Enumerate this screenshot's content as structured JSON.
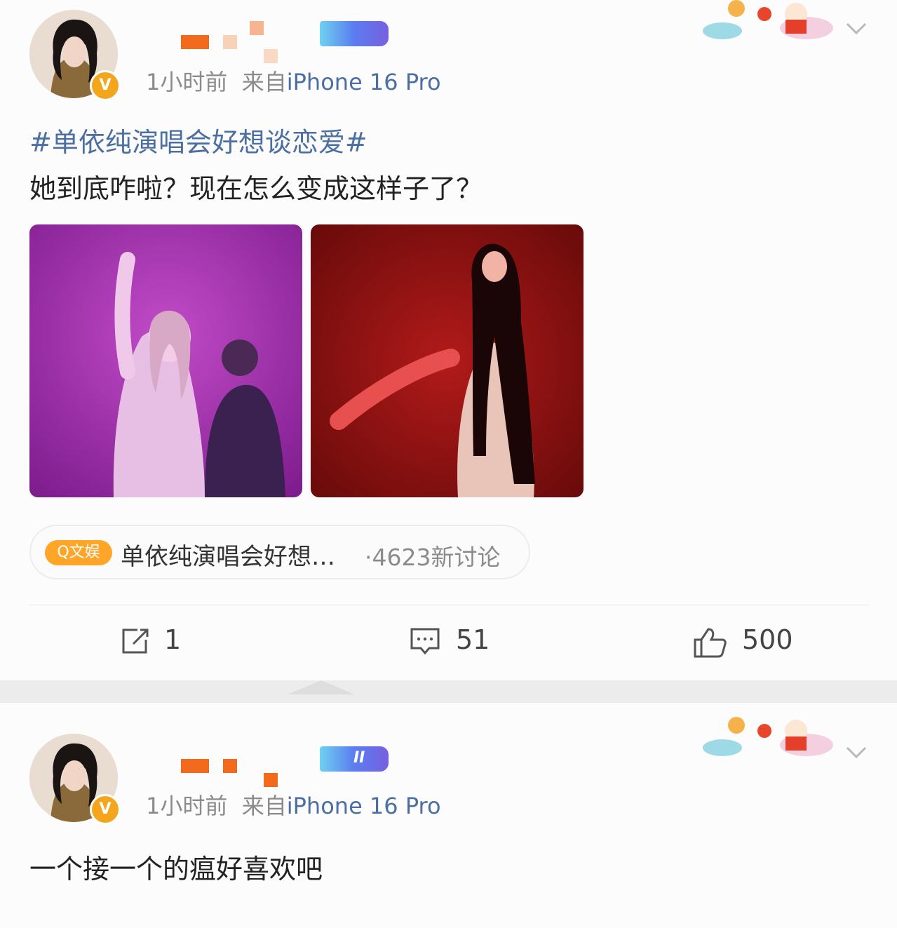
{
  "posts": [
    {
      "meta_time": "1小时前",
      "meta_from": "来自",
      "meta_device": "iPhone 16 Pro",
      "hashtag": "#单依纯演唱会好想谈恋爱#",
      "text": "她到底咋啦？现在怎么变成这样子了？",
      "topic": {
        "tag": "Q文娱",
        "title": "单依纯演唱会好想…",
        "count": "·4623新讨论"
      },
      "actions": {
        "repost": "1",
        "comment": "51",
        "like": "500"
      }
    },
    {
      "meta_time": "1小时前",
      "meta_from": "来自",
      "meta_device": "iPhone 16 Pro",
      "vip_level": "II",
      "text": "一个接一个的瘟好喜欢吧"
    }
  ],
  "icons": {
    "verified": "V",
    "repost": "repost-icon",
    "comment": "comment-icon",
    "like": "thumbs-up-icon",
    "more": "chevron-down-icon"
  },
  "colors": {
    "link": "#4b6fa3",
    "verified": "#f3a51c",
    "topic_tag": "#ffa528",
    "meta": "#8b8b8b"
  }
}
